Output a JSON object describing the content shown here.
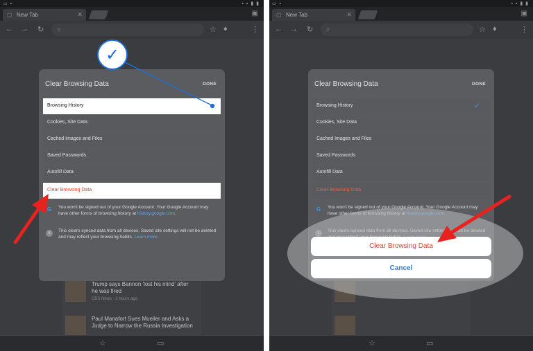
{
  "browser": {
    "tab_title": "New Tab",
    "tab_close": "✕",
    "tab_icon": "▢",
    "tabs_icon": "▣",
    "status_left": "▭ ▪",
    "status_right": "▪ ▪ ▮ ▮",
    "nav_back": "←",
    "nav_forward": "→",
    "nav_reload": "↻",
    "omnibox_icon": "⌕",
    "star_icon": "☆",
    "mic_icon": "♦",
    "menu_icon": "⋮"
  },
  "news": [
    {
      "text": "Trump says Bannon 'lost his mind' after he was fired",
      "meta": "CBS News · 2 hours ago"
    },
    {
      "text": "Paul Manafort Sues Mueller and Asks a Judge to Narrow the Russia Investigation",
      "meta": ""
    }
  ],
  "bottom": {
    "star": "☆",
    "book": "▭"
  },
  "dialog": {
    "title": "Clear Browsing Data",
    "done": "DONE",
    "items": [
      {
        "label": "Browsing History"
      },
      {
        "label": "Cookies, Site Data"
      },
      {
        "label": "Cached Images and Files"
      },
      {
        "label": "Saved Passwords"
      },
      {
        "label": "Autofill Data"
      }
    ],
    "checkmark": "✓",
    "clear_label": "Clear Browsing Data",
    "info1_icon": "G",
    "info1_text": "You won't be signed out of your Google Account. Your Google Account may have other forms of browsing history at ",
    "info1_link": "history.google.com",
    "info1_end": ".",
    "info2_icon": "i",
    "info2_text": "This clears synced data from all devices. Saved site settings will not be deleted and may reflect your browsing habits. ",
    "info2_link": "Learn more"
  },
  "annotation": {
    "check_glyph": "✓"
  },
  "sheet": {
    "confirm_label": "Clear Browsing Data",
    "cancel_label": "Cancel"
  },
  "colors": {
    "annotation_red": "#e8231f",
    "annotation_blue": "#1f6fd8",
    "destructive": "#e04030"
  }
}
